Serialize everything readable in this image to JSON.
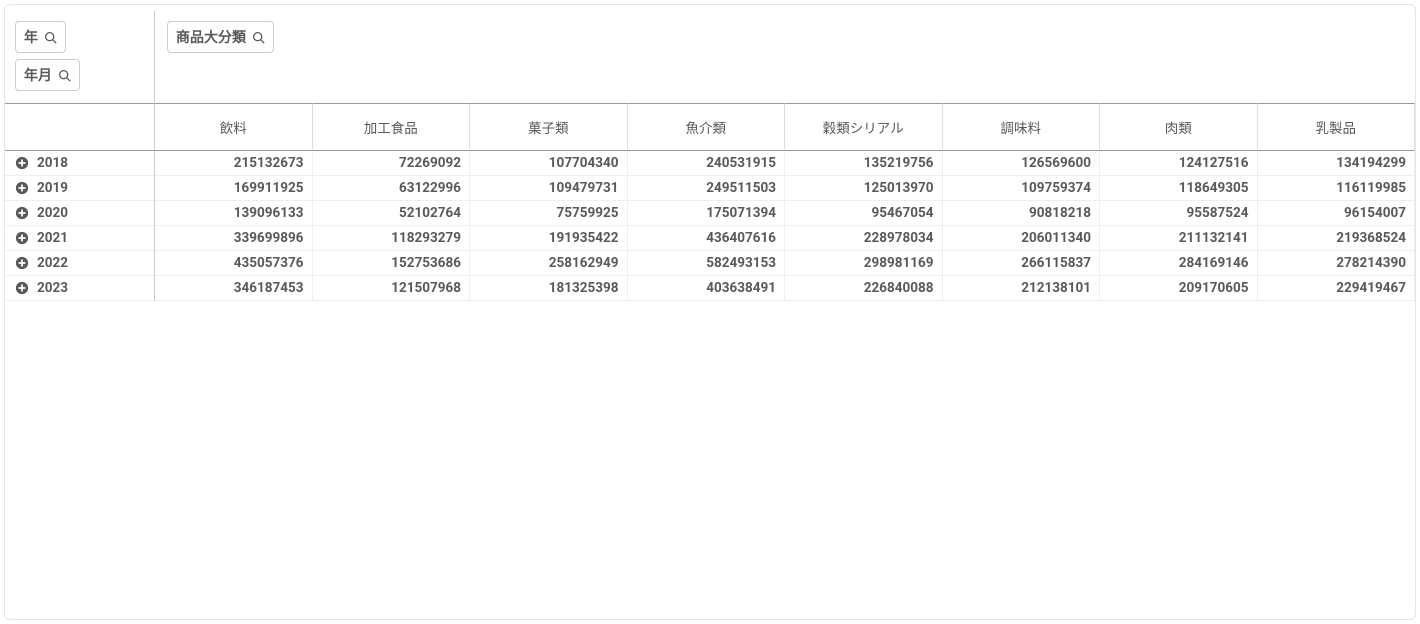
{
  "dimensions": {
    "rows": [
      {
        "label": "年"
      },
      {
        "label": "年月"
      }
    ],
    "column": {
      "label": "商品大分類"
    }
  },
  "columns": [
    "飲料",
    "加工食品",
    "菓子類",
    "魚介類",
    "穀類シリアル",
    "調味料",
    "肉類",
    "乳製品"
  ],
  "rows": [
    {
      "label": "2018",
      "values": [
        "215132673",
        "72269092",
        "107704340",
        "240531915",
        "135219756",
        "126569600",
        "124127516",
        "134194299"
      ]
    },
    {
      "label": "2019",
      "values": [
        "169911925",
        "63122996",
        "109479731",
        "249511503",
        "125013970",
        "109759374",
        "118649305",
        "116119985"
      ]
    },
    {
      "label": "2020",
      "values": [
        "139096133",
        "52102764",
        "75759925",
        "175071394",
        "95467054",
        "90818218",
        "95587524",
        "96154007"
      ]
    },
    {
      "label": "2021",
      "values": [
        "339699896",
        "118293279",
        "191935422",
        "436407616",
        "228978034",
        "206011340",
        "211132141",
        "219368524"
      ]
    },
    {
      "label": "2022",
      "values": [
        "435057376",
        "152753686",
        "258162949",
        "582493153",
        "298981169",
        "266115837",
        "284169146",
        "278214390"
      ]
    },
    {
      "label": "2023",
      "values": [
        "346187453",
        "121507968",
        "181325398",
        "403638491",
        "226840088",
        "212138101",
        "209170605",
        "229419467"
      ]
    }
  ]
}
